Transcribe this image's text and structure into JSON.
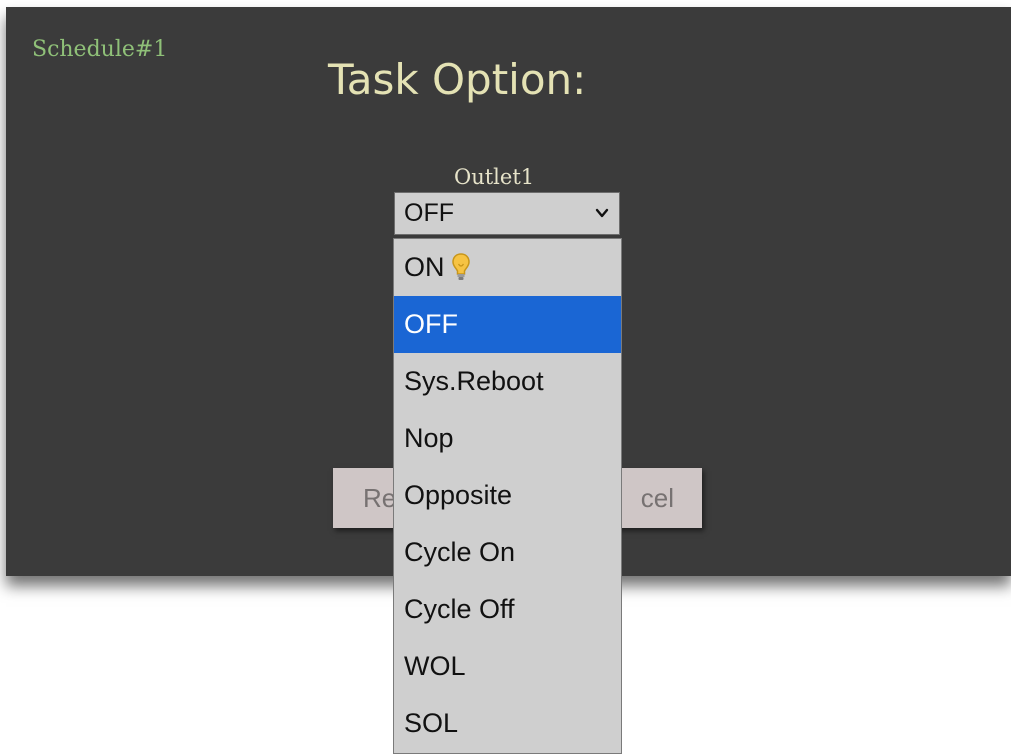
{
  "panel": {
    "schedule_label": "Schedule#1",
    "title": "Task Option:"
  },
  "outlet": {
    "label": "Outlet1",
    "selected_value": "OFF"
  },
  "buttons": {
    "reset_label": "Re",
    "cancel_label": "cel"
  },
  "dropdown": {
    "options": [
      {
        "label": "ON",
        "icon": "lightbulb-icon"
      },
      {
        "label": "OFF",
        "selected": true
      },
      {
        "label": "Sys.Reboot"
      },
      {
        "label": "Nop"
      },
      {
        "label": "Opposite"
      },
      {
        "label": "Cycle On"
      },
      {
        "label": "Cycle Off"
      },
      {
        "label": "WOL"
      },
      {
        "label": "SOL"
      }
    ]
  },
  "colors": {
    "panel_bg": "#3b3b3b",
    "schedule_label": "#8fc078",
    "title": "#e4e2b4",
    "highlight": "#1a66d4"
  }
}
